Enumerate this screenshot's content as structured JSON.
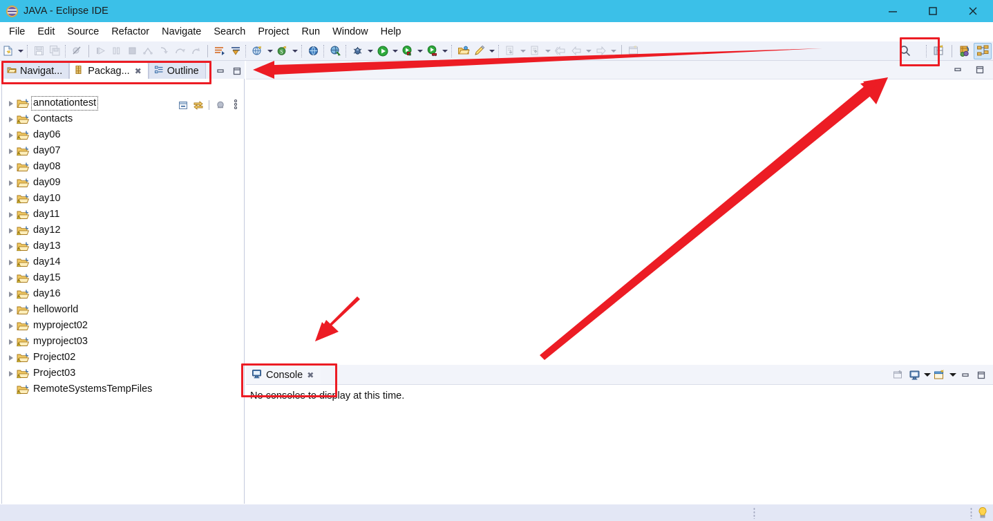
{
  "window": {
    "title": "JAVA - Eclipse IDE",
    "logo_icon": "eclipse-logo-icon",
    "titlebar_color": "#3bc0e8",
    "controls": [
      {
        "name": "minimize-button",
        "icon": "minimize-icon",
        "label": "Minimize"
      },
      {
        "name": "maximize-button",
        "icon": "maximize-icon",
        "label": "Maximize"
      },
      {
        "name": "close-button",
        "icon": "close-icon",
        "label": "Close"
      }
    ]
  },
  "menubar": {
    "items": [
      {
        "label": "File"
      },
      {
        "label": "Edit"
      },
      {
        "label": "Source"
      },
      {
        "label": "Refactor"
      },
      {
        "label": "Navigate"
      },
      {
        "label": "Search"
      },
      {
        "label": "Project"
      },
      {
        "label": "Run"
      },
      {
        "label": "Window"
      },
      {
        "label": "Help"
      }
    ]
  },
  "toolbar": {
    "buttons": [
      {
        "name": "new-wizard-button",
        "icon": "new-file-icon",
        "enabled": true,
        "dropdown": true
      },
      {
        "name": "save-button",
        "icon": "save-icon",
        "enabled": false,
        "dropdown": false
      },
      {
        "name": "save-all-button",
        "icon": "save-all-icon",
        "enabled": false,
        "dropdown": false
      },
      {
        "name": "skip-all-breakpoints-button",
        "icon": "skip-breakpoints-icon",
        "enabled": false,
        "dropdown": false
      },
      {
        "name": "resume-button",
        "icon": "resume-icon",
        "enabled": false,
        "dropdown": false
      },
      {
        "name": "suspend-button",
        "icon": "suspend-icon",
        "enabled": false,
        "dropdown": false
      },
      {
        "name": "terminate-button",
        "icon": "terminate-icon",
        "enabled": false,
        "dropdown": false
      },
      {
        "name": "disconnect-button",
        "icon": "disconnect-icon",
        "enabled": false,
        "dropdown": false
      },
      {
        "name": "step-into-button",
        "icon": "step-into-icon",
        "enabled": false,
        "dropdown": false
      },
      {
        "name": "step-over-button",
        "icon": "step-over-icon",
        "enabled": false,
        "dropdown": false
      },
      {
        "name": "step-return-button",
        "icon": "step-return-icon",
        "enabled": false,
        "dropdown": false
      },
      {
        "name": "next-annotation-button",
        "icon": "next-annotation-icon",
        "enabled": true,
        "dropdown": false
      },
      {
        "name": "previous-annotation-button",
        "icon": "previous-annotation-icon",
        "enabled": true,
        "dropdown": false
      },
      {
        "name": "new-java-project-button",
        "icon": "new-java-project-icon",
        "enabled": true,
        "dropdown": true
      },
      {
        "name": "new-class-button",
        "icon": "new-class-icon",
        "enabled": true,
        "dropdown": true
      },
      {
        "name": "open-type-button",
        "icon": "open-type-icon",
        "enabled": true,
        "dropdown": false
      },
      {
        "name": "search-web-button",
        "icon": "search-web-icon",
        "enabled": true,
        "dropdown": false
      },
      {
        "name": "debug-button",
        "icon": "debug-bug-icon",
        "enabled": true,
        "dropdown": true
      },
      {
        "name": "run-button",
        "icon": "run-green-play-icon",
        "enabled": true,
        "dropdown": true
      },
      {
        "name": "coverage-button",
        "icon": "coverage-icon",
        "enabled": true,
        "dropdown": true
      },
      {
        "name": "run-as-button",
        "icon": "run-as-icon",
        "enabled": true,
        "dropdown": true
      },
      {
        "name": "open-task-button",
        "icon": "open-folder-icon",
        "enabled": true,
        "dropdown": false
      },
      {
        "name": "new-annotation-button",
        "icon": "pencil-icon",
        "enabled": true,
        "dropdown": true
      },
      {
        "name": "commit-button",
        "icon": "commit-icon",
        "enabled": false,
        "dropdown": true
      },
      {
        "name": "push-button",
        "icon": "push-icon",
        "enabled": false,
        "dropdown": true
      },
      {
        "name": "back-history-button",
        "icon": "back-arrow-icon",
        "enabled": false,
        "dropdown": false
      },
      {
        "name": "previous-edit-button",
        "icon": "left-arrow-icon",
        "enabled": false,
        "dropdown": true
      },
      {
        "name": "forward-history-button",
        "icon": "right-arrow-icon",
        "enabled": false,
        "dropdown": true
      },
      {
        "name": "new-editor-button",
        "icon": "new-editor-icon",
        "enabled": false,
        "dropdown": false
      }
    ],
    "quick_access": {
      "name": "quick-access-search-button",
      "icon": "search-icon",
      "tooltip": "Quick Access",
      "highlighted": true
    },
    "perspectives": [
      {
        "name": "open-perspective-button",
        "icon": "open-perspective-icon",
        "active": false
      },
      {
        "name": "perspective-debug",
        "icon": "debug-perspective-icon",
        "active": false
      },
      {
        "name": "perspective-java",
        "icon": "java-perspective-icon",
        "active": true
      }
    ]
  },
  "left_view": {
    "tabs": [
      {
        "label": "Navigat...",
        "icon": "navigator-icon",
        "active": false,
        "closable": false
      },
      {
        "label": "Packag...",
        "icon": "package-explorer-icon",
        "active": true,
        "closable": true
      },
      {
        "label": "Outline",
        "icon": "outline-icon",
        "active": false,
        "closable": false
      }
    ],
    "tab_controls": [
      {
        "name": "view-minimize-button",
        "icon": "minimize-icon"
      },
      {
        "name": "view-maximize-button",
        "icon": "maximize-icon"
      }
    ],
    "view_toolbar": [
      {
        "name": "collapse-all-button",
        "icon": "collapse-all-icon"
      },
      {
        "name": "link-with-editor-button",
        "icon": "link-with-editor-icon"
      },
      {
        "name": "view-menu-button",
        "icon": "view-menu-icon"
      },
      {
        "name": "view-overflow-menu",
        "icon": "vertical-dots-icon"
      }
    ],
    "tree": [
      {
        "label": "annotationtest",
        "icon": "java-project-icon",
        "expandable": true,
        "warning": false,
        "focused": true
      },
      {
        "label": "Contacts",
        "icon": "java-project-warning-icon",
        "expandable": true,
        "warning": true,
        "focused": false
      },
      {
        "label": "day06",
        "icon": "java-project-warning-icon",
        "expandable": true,
        "warning": true,
        "focused": false
      },
      {
        "label": "day07",
        "icon": "java-project-warning-icon",
        "expandable": true,
        "warning": true,
        "focused": false
      },
      {
        "label": "day08",
        "icon": "java-project-icon",
        "expandable": true,
        "warning": false,
        "focused": false
      },
      {
        "label": "day09",
        "icon": "java-project-icon",
        "expandable": true,
        "warning": false,
        "focused": false
      },
      {
        "label": "day10",
        "icon": "java-project-warning-icon",
        "expandable": true,
        "warning": true,
        "focused": false
      },
      {
        "label": "day11",
        "icon": "java-project-warning-icon",
        "expandable": true,
        "warning": true,
        "focused": false
      },
      {
        "label": "day12",
        "icon": "java-project-warning-icon",
        "expandable": true,
        "warning": true,
        "focused": false
      },
      {
        "label": "day13",
        "icon": "java-project-warning-icon",
        "expandable": true,
        "warning": true,
        "focused": false
      },
      {
        "label": "day14",
        "icon": "java-project-warning-icon",
        "expandable": true,
        "warning": true,
        "focused": false
      },
      {
        "label": "day15",
        "icon": "java-project-warning-icon",
        "expandable": true,
        "warning": true,
        "focused": false
      },
      {
        "label": "day16",
        "icon": "java-project-warning-icon",
        "expandable": true,
        "warning": true,
        "focused": false
      },
      {
        "label": "helloworld",
        "icon": "java-project-icon",
        "expandable": true,
        "warning": false,
        "focused": false
      },
      {
        "label": "myproject02",
        "icon": "java-project-icon",
        "expandable": true,
        "warning": false,
        "focused": false
      },
      {
        "label": "myproject03",
        "icon": "java-project-warning-icon",
        "expandable": true,
        "warning": true,
        "focused": false
      },
      {
        "label": "Project02",
        "icon": "java-project-warning-icon",
        "expandable": true,
        "warning": true,
        "focused": false
      },
      {
        "label": "Project03",
        "icon": "java-project-warning-icon",
        "expandable": true,
        "warning": true,
        "focused": false
      },
      {
        "label": "RemoteSystemsTempFiles",
        "icon": "java-project-warning-icon",
        "expandable": false,
        "warning": true,
        "focused": false
      }
    ]
  },
  "editor": {
    "controls": [
      {
        "name": "editor-minimize-button",
        "icon": "minimize-icon"
      },
      {
        "name": "editor-maximize-button",
        "icon": "maximize-icon"
      }
    ]
  },
  "console": {
    "tab": {
      "label": "Console",
      "icon": "console-monitor-icon",
      "closable": true,
      "active": true
    },
    "message": "No consoles to display at this time.",
    "toolbar": [
      {
        "name": "pin-console-button",
        "icon": "pin-console-icon",
        "dropdown": false
      },
      {
        "name": "display-selected-console-button",
        "icon": "console-monitor-icon",
        "dropdown": true
      },
      {
        "name": "open-console-button",
        "icon": "open-console-icon",
        "dropdown": true
      },
      {
        "name": "console-minimize-button",
        "icon": "minimize-icon",
        "dropdown": false
      },
      {
        "name": "console-maximize-button",
        "icon": "maximize-icon",
        "dropdown": false
      }
    ]
  },
  "statusbar": {
    "tip_icon": "lightbulb-icon"
  },
  "annotations": {
    "color": "#ec1c24",
    "boxes": [
      {
        "name": "highlight-view-tabs",
        "target": "left view tab row (Navigator / Package Explorer / Outline)"
      },
      {
        "name": "highlight-quick-access",
        "target": "Quick Access search button in toolbar"
      },
      {
        "name": "highlight-console-tab",
        "target": "Console view tab"
      }
    ],
    "arrows": [
      {
        "name": "arrow-to-view-tabs",
        "direction": "left",
        "from": "toolbar right area",
        "to": "left view tab row"
      },
      {
        "name": "arrow-to-quick-access",
        "direction": "up-right",
        "from": "editor area",
        "to": "Quick Access search button"
      },
      {
        "name": "arrow-to-console-tab",
        "direction": "down-left",
        "from": "editor area",
        "to": "Console tab"
      }
    ]
  }
}
